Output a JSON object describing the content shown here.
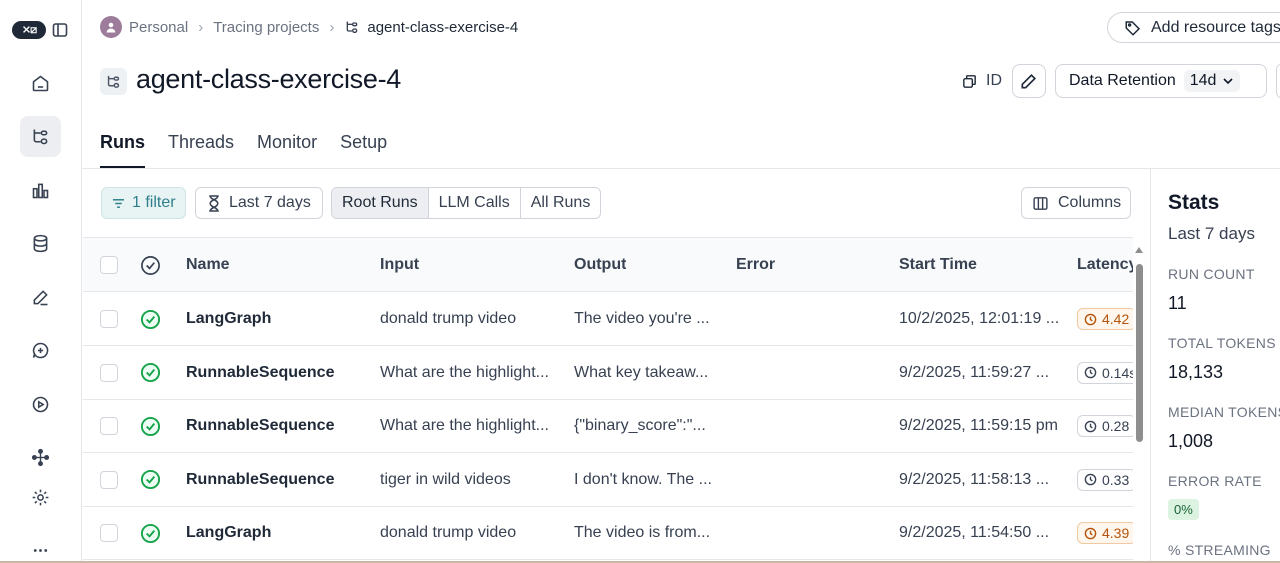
{
  "breadcrumb": {
    "workspace": "Personal",
    "section": "Tracing projects",
    "current": "agent-class-exercise-4"
  },
  "header": {
    "add_tags_label": "Add resource tags",
    "project_title": "agent-class-exercise-4",
    "id_label": "ID",
    "retention_label": "Data Retention",
    "retention_value": "14d"
  },
  "tabs": [
    {
      "label": "Runs",
      "active": true
    },
    {
      "label": "Threads"
    },
    {
      "label": "Monitor"
    },
    {
      "label": "Setup"
    }
  ],
  "toolbar": {
    "filter_label": "1 filter",
    "date_label": "Last 7 days",
    "segments": [
      "Root Runs",
      "LLM Calls",
      "All Runs"
    ],
    "columns_label": "Columns"
  },
  "table": {
    "headers": {
      "name": "Name",
      "input": "Input",
      "output": "Output",
      "error": "Error",
      "start_time": "Start Time",
      "latency": "Latency"
    },
    "rows": [
      {
        "name": "LangGraph",
        "input": "donald trump video",
        "output": "The video you're ...",
        "error": "",
        "start_time": "10/2/2025, 12:01:19 ...",
        "latency": "4.42",
        "slow": true
      },
      {
        "name": "RunnableSequence",
        "input": "What are the highlight...",
        "output": "What key takeaw...",
        "error": "",
        "start_time": "9/2/2025, 11:59:27 ...",
        "latency": "0.14s",
        "slow": false
      },
      {
        "name": "RunnableSequence",
        "input": "What are the highlight...",
        "output": "{\"binary_score\":\"...",
        "error": "",
        "start_time": "9/2/2025, 11:59:15 pm",
        "latency": "0.28",
        "slow": false
      },
      {
        "name": "RunnableSequence",
        "input": "tiger in wild videos",
        "output": "I don't know. The ...",
        "error": "",
        "start_time": "9/2/2025, 11:58:13 ...",
        "latency": "0.33",
        "slow": false
      },
      {
        "name": "LangGraph",
        "input": "donald trump video",
        "output": "The video is from...",
        "error": "",
        "start_time": "9/2/2025, 11:54:50 ...",
        "latency": "4.39",
        "slow": true
      }
    ]
  },
  "stats": {
    "title": "Stats",
    "period": "Last 7 days",
    "run_count_label": "RUN COUNT",
    "run_count": "11",
    "total_tokens_label": "TOTAL TOKENS",
    "total_tokens": "18,133",
    "median_tokens_label": "MEDIAN TOKENS",
    "median_tokens": "1,008",
    "error_rate_label": "ERROR RATE",
    "error_rate": "0%",
    "streaming_label": "% STREAMING"
  },
  "colors": {
    "accent": "#2f7f8c",
    "success": "#16a34a",
    "latency_slow": "#b45309"
  },
  "icons": [
    "logo",
    "sidebar-collapse-icon",
    "home-icon",
    "tracing-icon",
    "dashboard-icon",
    "datasets-icon",
    "annotation-icon",
    "prompts-icon",
    "playground-icon",
    "deployments-icon",
    "settings-icon",
    "more-icon"
  ]
}
